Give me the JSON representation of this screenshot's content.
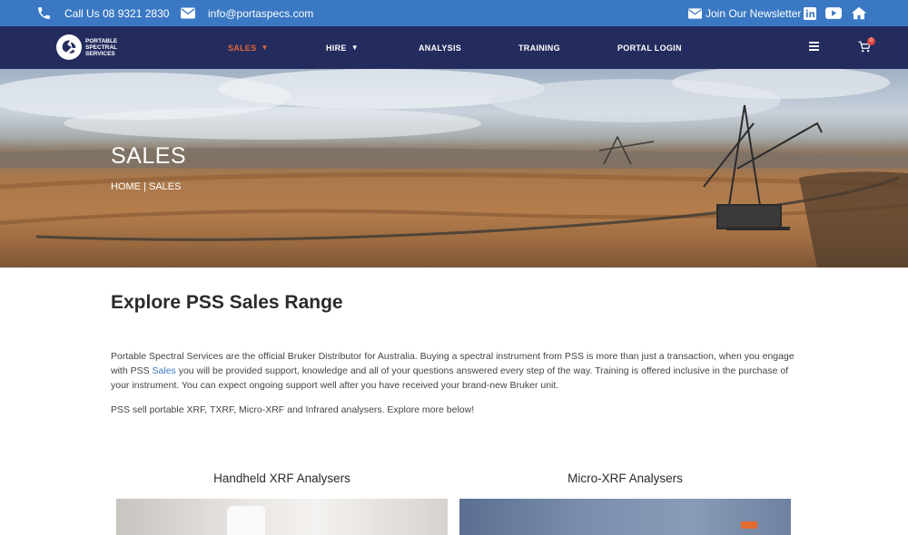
{
  "topbar": {
    "phone": "Call Us 08 9321 2830",
    "email": "info@portaspecs.com",
    "newsletter": "Join Our Newsletter",
    "icons": [
      "phone-icon",
      "envelope-icon",
      "envelope-icon",
      "linkedin-icon",
      "youtube-icon",
      "home-icon"
    ]
  },
  "nav": {
    "logo": [
      "PORTABLE",
      "SPECTRAL",
      "SERVICES"
    ],
    "items": [
      {
        "label": "SALES",
        "dropdown": true,
        "active": true
      },
      {
        "label": "HIRE",
        "dropdown": true
      },
      {
        "label": "ANALYSIS"
      },
      {
        "label": "TRAINING"
      },
      {
        "label": "PORTAL LOGIN"
      }
    ],
    "cart_count": "0"
  },
  "hero": {
    "title": "SALES",
    "breadcrumb_home": "HOME",
    "breadcrumb_sep": " | ",
    "breadcrumb_current": "SALES"
  },
  "content": {
    "heading": "Explore PSS Sales Range",
    "para_part1": "Portable Spectral Services are the official Bruker Distributor for Australia. Buying a spectral instrument from PSS is more than just a transaction, when you engage with PSS ",
    "para_link": "Sales",
    "para_part2": " you will be provided support, knowledge and all of your questions answered every step of the way. Training is offered inclusive in the purchase of your instrument. You can expect ongoing support well after you have received your brand-new Bruker unit.",
    "para2": "PSS sell portable XRF, TXRF, Micro-XRF and Infrared analysers. Explore more below!"
  },
  "cards": [
    {
      "title": "Handheld XRF Analysers"
    },
    {
      "title": "Micro-XRF Analysers"
    }
  ],
  "colors": {
    "topbar": "#3a78c3",
    "navbar": "#242c5e",
    "active_nav": "#e0673a",
    "link": "#3a78c3"
  }
}
